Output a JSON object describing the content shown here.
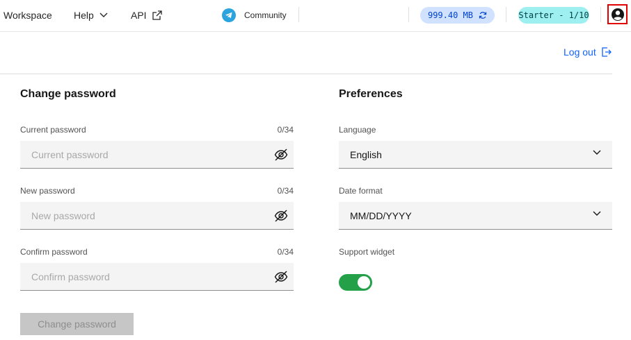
{
  "header": {
    "nav": {
      "workspace": "Workspace",
      "help": "Help",
      "api": "API"
    },
    "community": "Community",
    "storage": "999.40 MB",
    "plan": "Starter - 1/10",
    "icons": [
      "chevron-down-icon",
      "external-link-icon",
      "telegram-icon",
      "refresh-icon",
      "user-avatar-icon"
    ]
  },
  "logout": {
    "label": "Log out",
    "icon": "logout-icon"
  },
  "change_password": {
    "title": "Change password",
    "fields": [
      {
        "label": "Current password",
        "counter": "0/34",
        "placeholder": "Current password",
        "value": ""
      },
      {
        "label": "New password",
        "counter": "0/34",
        "placeholder": "New password",
        "value": ""
      },
      {
        "label": "Confirm password",
        "counter": "0/34",
        "placeholder": "Confirm password",
        "value": ""
      }
    ],
    "submit_label": "Change password"
  },
  "preferences": {
    "title": "Preferences",
    "language": {
      "label": "Language",
      "value": "English"
    },
    "date_format": {
      "label": "Date format",
      "value": "MM/DD/YYYY"
    },
    "support_widget": {
      "label": "Support widget",
      "enabled": true
    }
  },
  "colors": {
    "accent": "#0f62fe",
    "storage_pill_bg": "#d0e2ff",
    "plan_pill_bg": "#9ef0f0",
    "toggle_on": "#24a148",
    "telegram": "#2aa3df",
    "highlight_border": "#e00000"
  }
}
